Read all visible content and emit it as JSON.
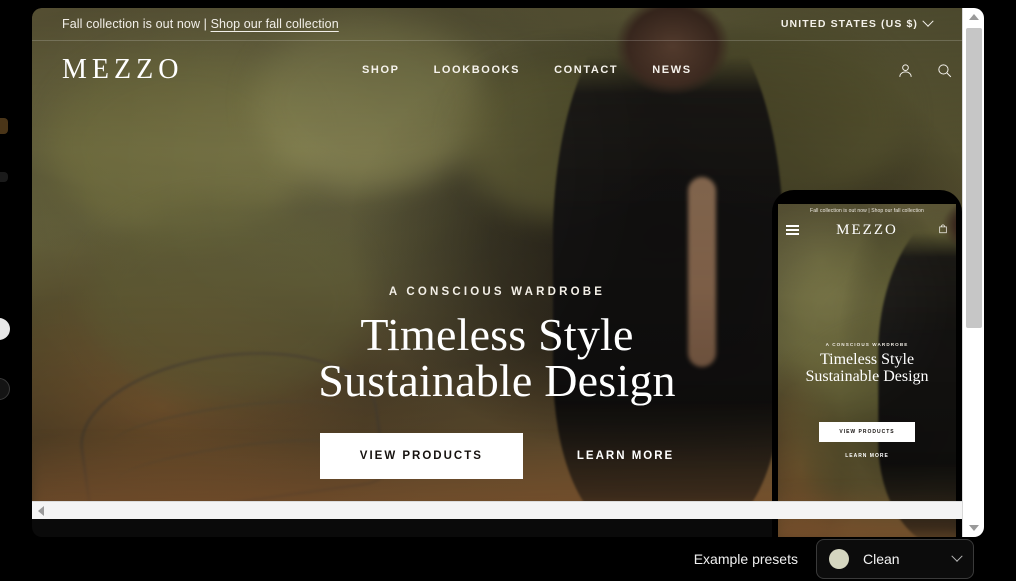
{
  "announcement": {
    "text_prefix": "Fall collection is out now | ",
    "link_text": "Shop our fall collection",
    "country": "UNITED STATES (US $)"
  },
  "nav": {
    "brand": "MEZZO",
    "links": [
      {
        "label": "SHOP"
      },
      {
        "label": "LOOKBOOKS"
      },
      {
        "label": "CONTACT"
      },
      {
        "label": "NEWS"
      }
    ],
    "icons": [
      {
        "name": "account-icon"
      },
      {
        "name": "search-icon"
      },
      {
        "name": "bag-icon"
      }
    ]
  },
  "hero": {
    "eyebrow": "A CONSCIOUS WARDROBE",
    "title_line1": "Timeless Style",
    "title_line2": "Sustainable Design",
    "primary_cta": "VIEW PRODUCTS",
    "secondary_cta": "LEARN MORE"
  },
  "mobile": {
    "announcement": "Fall collection is out now | Shop our fall collection",
    "brand": "MEZZO",
    "eyebrow": "A CONSCIOUS WARDROBE",
    "title_line1": "Timeless Style",
    "title_line2": "Sustainable Design",
    "primary_cta": "VIEW PRODUCTS",
    "secondary_cta": "LEARN MORE"
  },
  "bottom_bar": {
    "presets_label": "Example presets",
    "selected_preset": "Clean",
    "selected_preset_color": "#d5d6c0"
  }
}
